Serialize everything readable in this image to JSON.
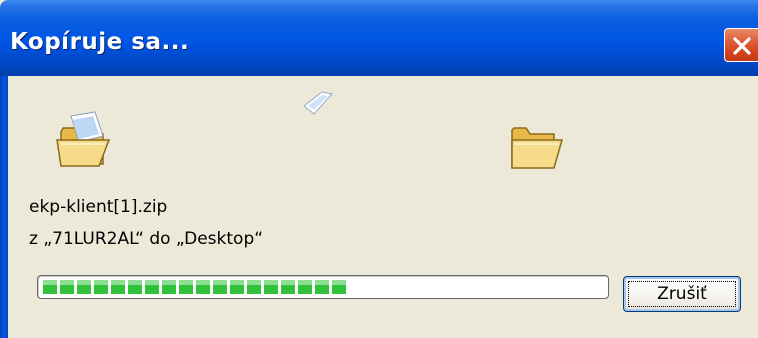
{
  "window": {
    "title": "Kopíruje sa..."
  },
  "icons": {
    "source": "folder-open-icon",
    "flying": "paper-sheet-icon",
    "destination": "folder-open-icon",
    "close": "close-icon"
  },
  "copy": {
    "file_name": "ekp-klient[1].zip",
    "path_text": "z „71LUR2AL“ do „Desktop“",
    "progress_fraction": 0.55
  },
  "buttons": {
    "cancel_label": "Zrušiť"
  },
  "colors": {
    "title_bar": "#0055e5",
    "close_button": "#d3421c",
    "progress": "#2fc23a",
    "client_bg": "#ece9d8"
  }
}
